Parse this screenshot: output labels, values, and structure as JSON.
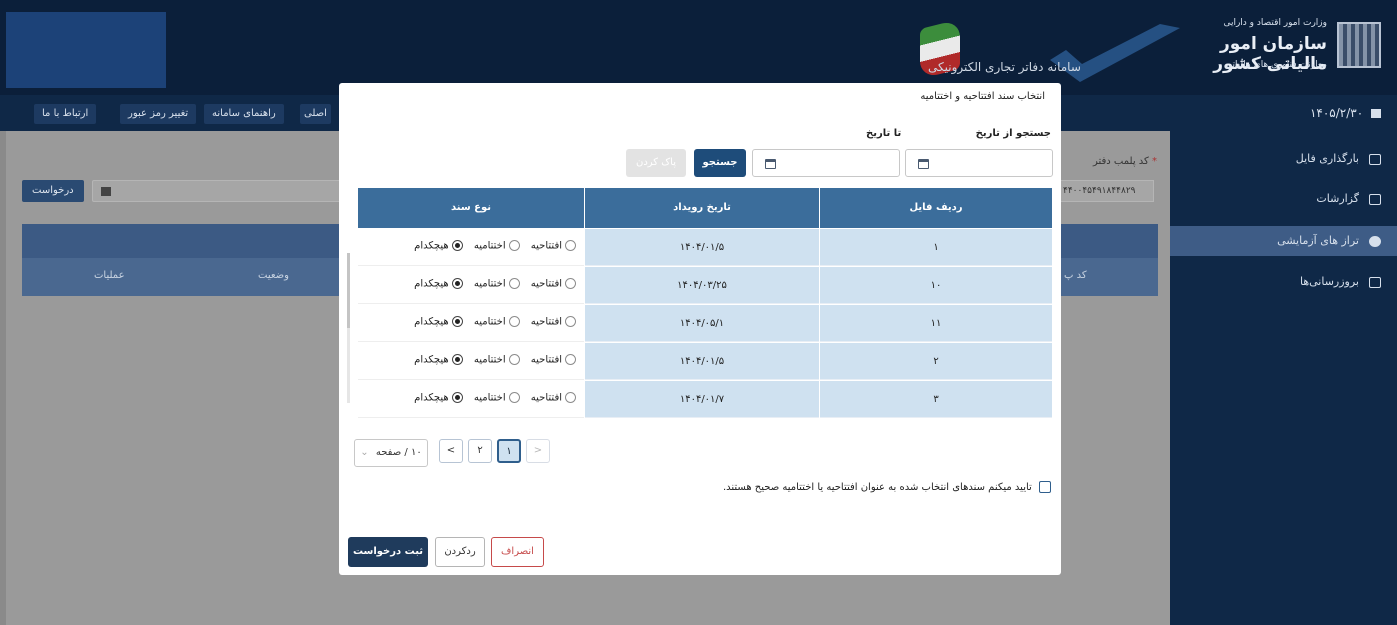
{
  "header": {
    "ministry": "وزارت امور اقتصاد و دارایی",
    "org_name": "سازمان امور مالیاتی کشور",
    "deputy": "معاونت فناوری های مالیاتی",
    "system_title": "سامانه دفاتر تجاری الکترونیکی"
  },
  "nav": {
    "contact": "ارتباط با ما",
    "change_password": "تغییر رمز عبور",
    "guide": "راهنمای سامانه",
    "main_partial": "اصلی",
    "date": "۱۴۰۵/۲/۳۰"
  },
  "sidebar": {
    "items": [
      {
        "label": "بارگذاری فایل"
      },
      {
        "label": "گزارشات"
      },
      {
        "label": "تراز های آزمایشی"
      },
      {
        "label": "بروزرسانی‌ها"
      }
    ]
  },
  "background": {
    "request_button": "درخواست",
    "seal_label": "کد پلمب دفتر",
    "seal_value": "۴۴۰۰۴۵۴۹۱۸۴۴۸۲۹",
    "col_operations": "عملیات",
    "col_status": "وضعیت",
    "col_code_partial": "کد پ"
  },
  "modal": {
    "title": "انتخاب سند افتتاحیه و اختتامیه",
    "from_label": "جستجو از تاریخ",
    "to_label": "تا تاریخ",
    "search_button": "جستجو",
    "clear_button": "پاک کردن",
    "columns": {
      "row": "ردیف فایل",
      "date": "تاریخ رویداد",
      "type": "نوع سند"
    },
    "rows": [
      {
        "row": "۱",
        "date": "۱۴۰۴/۰۱/۵",
        "selected": "none"
      },
      {
        "row": "۱۰",
        "date": "۱۴۰۴/۰۳/۲۵",
        "selected": "none"
      },
      {
        "row": "۱۱",
        "date": "۱۴۰۴/۰۵/۱",
        "selected": "none"
      },
      {
        "row": "۲",
        "date": "۱۴۰۴/۰۱/۵",
        "selected": "none"
      },
      {
        "row": "۳",
        "date": "۱۴۰۴/۰۱/۷",
        "selected": "none"
      }
    ],
    "radio_labels": {
      "opening": "افتتاحیه",
      "closing": "اختتامیه",
      "none": "هیچکدام"
    },
    "pagination": {
      "page_size": "۱۰ / صفحه",
      "pages": [
        "۱",
        "۲"
      ],
      "current": "۱"
    },
    "confirm_text": "تایید میکنم سندهای انتخاب شده به عنوان افتتاحیه یا اختتامیه صحیح هستند.",
    "submit_button": "ثبت درخواست",
    "reject_button": "ردکردن",
    "cancel_button": "انصراف"
  },
  "colors": {
    "primary": "#1e4c7a",
    "table_header": "#3b6d9b",
    "row_fill": "#cfe1f0",
    "cancel": "#c64a4a"
  }
}
